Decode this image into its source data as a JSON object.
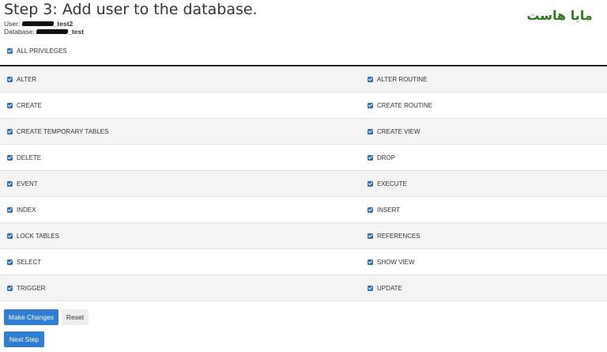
{
  "page": {
    "title": "Step 3: Add user to the database.",
    "user_label": "User:",
    "user_value_suffix": "_test2",
    "database_label": "Database:",
    "database_value_suffix": "_test"
  },
  "logo": {
    "text": "مایا هاست"
  },
  "all_privileges": {
    "label": "ALL PRIVILEGES",
    "checked": true
  },
  "privileges": [
    {
      "left": "ALTER",
      "right": "ALTER ROUTINE"
    },
    {
      "left": "CREATE",
      "right": "CREATE ROUTINE"
    },
    {
      "left": "CREATE TEMPORARY TABLES",
      "right": "CREATE VIEW"
    },
    {
      "left": "DELETE",
      "right": "DROP"
    },
    {
      "left": "EVENT",
      "right": "EXECUTE"
    },
    {
      "left": "INDEX",
      "right": "INSERT"
    },
    {
      "left": "LOCK TABLES",
      "right": "REFERENCES"
    },
    {
      "left": "SELECT",
      "right": "SHOW VIEW"
    },
    {
      "left": "TRIGGER",
      "right": "UPDATE"
    }
  ],
  "buttons": {
    "make_changes": "Make Changes",
    "reset": "Reset",
    "next_step": "Next Step"
  },
  "colors": {
    "accent": "#2f7ed1",
    "checkbox": "#2f6fb6",
    "logo": "#2d7a1f"
  }
}
